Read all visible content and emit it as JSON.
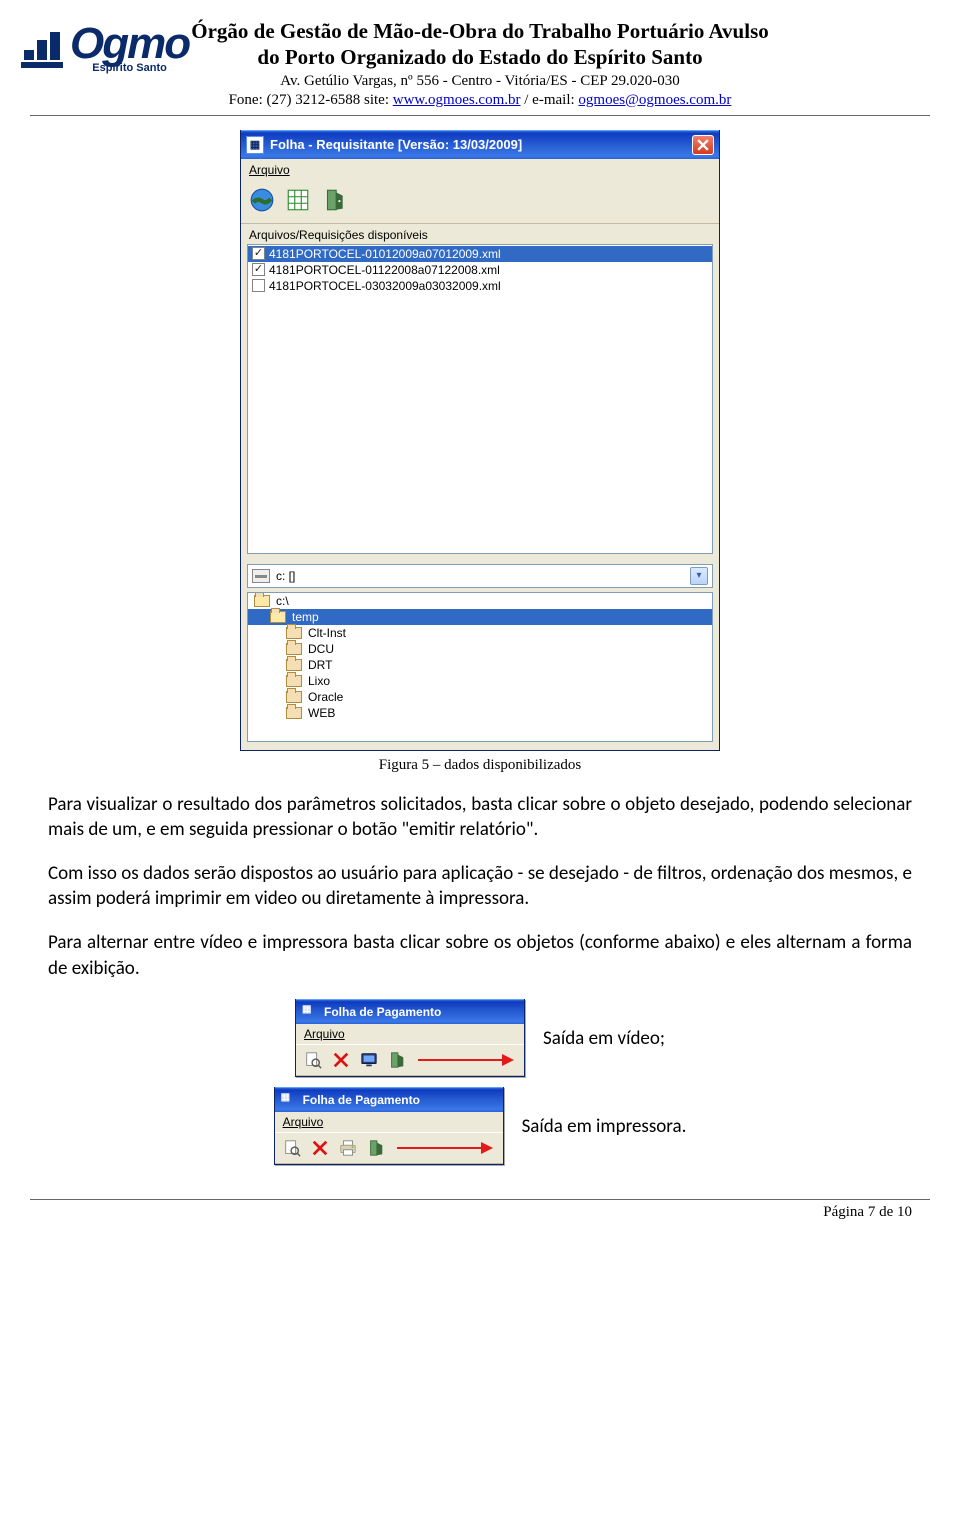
{
  "header": {
    "org_line1": "Órgão de Gestão de Mão-de-Obra do Trabalho Portuário Avulso",
    "org_line2": "do Porto Organizado do Estado do Espírito Santo",
    "address": "Av. Getúlio Vargas, nº 556 - Centro - Vitória/ES - CEP 29.020-030",
    "phone_prefix": "Fone: (27) 3212-6588 site: ",
    "site_url": "www.ogmoes.com.br",
    "divider": " / e-mail: ",
    "email": "ogmoes@ogmoes.com.br",
    "logo_text": "Ogmo",
    "logo_sub": "Espírito Santo"
  },
  "dialog": {
    "title": "Folha - Requisitante  [Versão: 13/03/2009]",
    "menu_arquivo": "Arquivo",
    "panel_label": "Arquivos/Requisições disponíveis",
    "files": [
      {
        "name": "4181PORTOCEL-01012009a07012009.xml",
        "checked": true,
        "selected": true
      },
      {
        "name": "4181PORTOCEL-01122008a07122008.xml",
        "checked": true,
        "selected": false
      },
      {
        "name": "4181PORTOCEL-03032009a03032009.xml",
        "checked": false,
        "selected": false
      }
    ],
    "drive_label": "c: []",
    "dirs": [
      {
        "name": "c:\\",
        "depth": 0,
        "open": true
      },
      {
        "name": "temp",
        "depth": 1,
        "open": true,
        "selected": true
      },
      {
        "name": "Clt-Inst",
        "depth": 2
      },
      {
        "name": "DCU",
        "depth": 2
      },
      {
        "name": "DRT",
        "depth": 2
      },
      {
        "name": "Lixo",
        "depth": 2
      },
      {
        "name": "Oracle",
        "depth": 2
      },
      {
        "name": "WEB",
        "depth": 2
      }
    ]
  },
  "figcaption": "Figura 5 – dados disponibilizados",
  "body": {
    "p1": "Para visualizar o resultado dos parâmetros solicitados, basta clicar sobre o objeto desejado, podendo selecionar mais de um, e em seguida pressionar o botão \"emitir relatório\".",
    "p2": "Com isso os dados serão dispostos ao usuário para aplicação - se desejado - de filtros, ordenação dos mesmos, e assim poderá imprimir em video ou diretamente à impressora.",
    "p3": "Para alternar entre vídeo e impressora basta clicar sobre os objetos (conforme abaixo) e eles alternam a forma de exibição."
  },
  "small_windows": {
    "title": "Folha de Pagamento",
    "menu": "Arquivo",
    "label_video": "Saída em vídeo;",
    "label_printer": "Saída em impressora."
  },
  "footer": {
    "page": "Página 7 de 10"
  }
}
